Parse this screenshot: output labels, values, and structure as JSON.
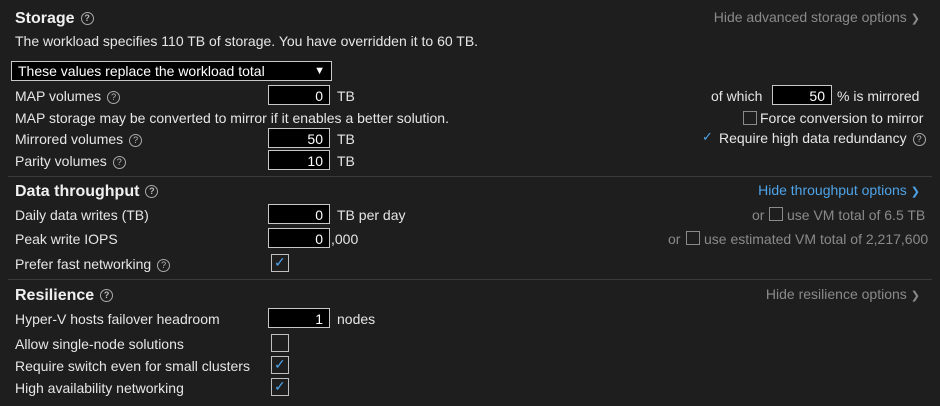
{
  "storage": {
    "title": "Storage",
    "hide_link": "Hide advanced storage options",
    "description": "The workload specifies 110 TB of storage. You have overridden it to 60 TB.",
    "select_value": "These values replace the workload total",
    "map_label": "MAP volumes",
    "map_value": "0",
    "map_unit": "TB",
    "of_which_label": "of which",
    "mirrored_pct": "50",
    "mirrored_pct_suffix": "% is mirrored",
    "map_note": "MAP storage may be converted to mirror if it enables a better solution.",
    "force_label": "Force conversion to mirror",
    "force_checked": false,
    "mirrored_label": "Mirrored volumes",
    "mirrored_value": "50",
    "mirrored_unit": "TB",
    "redundancy_label": "Require high data redundancy",
    "redundancy_checked": true,
    "parity_label": "Parity volumes",
    "parity_value": "10",
    "parity_unit": "TB"
  },
  "throughput": {
    "title": "Data throughput",
    "hide_link": "Hide throughput options",
    "daily_label": "Daily data writes (TB)",
    "daily_value": "0",
    "daily_unit": "TB per day",
    "daily_or": "or",
    "daily_alt": "use VM total of 6.5 TB",
    "peak_label": "Peak write IOPS",
    "peak_value": "0",
    "peak_unit": ",000",
    "peak_or": "or",
    "peak_alt": "use estimated VM total of 2,217,600",
    "fast_label": "Prefer fast networking",
    "fast_checked": true
  },
  "resilience": {
    "title": "Resilience",
    "hide_link": "Hide resilience options",
    "failover_label": "Hyper-V hosts failover headroom",
    "failover_value": "1",
    "failover_unit": "nodes",
    "single_label": "Allow single-node solutions",
    "single_checked": false,
    "switch_label": "Require switch even for small clusters",
    "switch_checked": true,
    "ha_label": "High availability networking",
    "ha_checked": true
  },
  "icons": {
    "help": "help-circle-icon",
    "chevron": "chevron-down-icon",
    "check": "check-icon"
  }
}
